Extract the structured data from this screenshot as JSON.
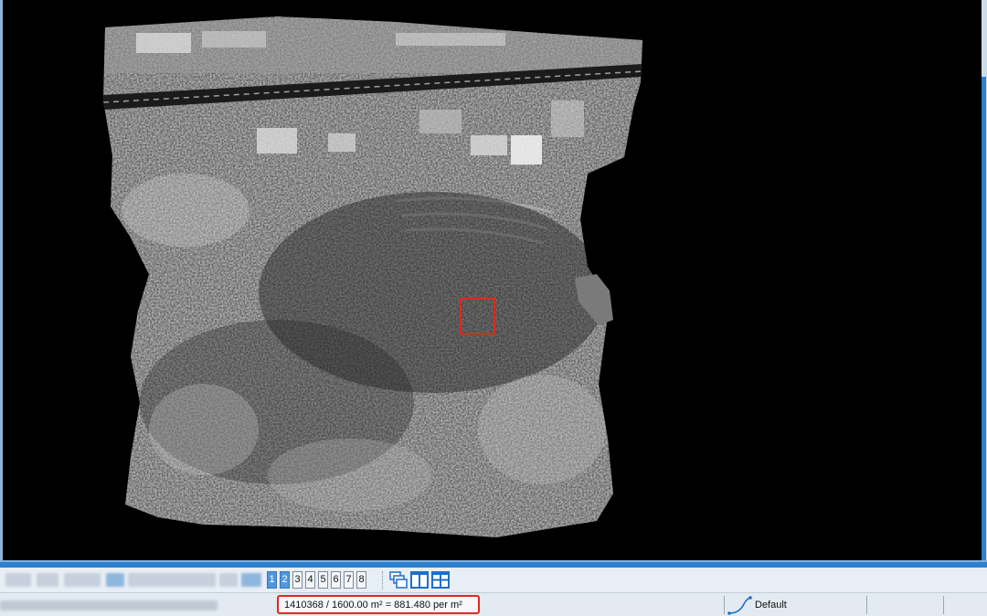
{
  "viewport": {
    "background": "#000000",
    "selection_color": "#e0281f"
  },
  "toolbar": {
    "viewport_tabs": [
      "1",
      "2",
      "3",
      "4",
      "5",
      "6",
      "7",
      "8"
    ],
    "active_tabs": [
      "1",
      "2"
    ],
    "layout_icons": [
      "cascade-windows-icon",
      "split-vertical-icon",
      "split-quad-icon"
    ]
  },
  "statusbar": {
    "density": "1410368 / 1600.00 m² = 881.480 per m²",
    "profile": "Default",
    "profile_icon": "curve-profile-icon"
  }
}
